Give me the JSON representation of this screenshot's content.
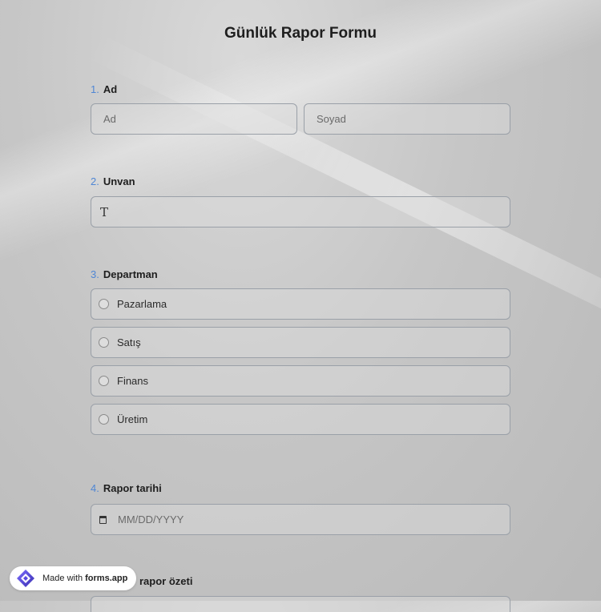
{
  "form": {
    "title": "Günlük Rapor Formu"
  },
  "q1": {
    "number": "1.",
    "label": "Ad",
    "first_placeholder": "Ad",
    "last_placeholder": "Soyad"
  },
  "q2": {
    "number": "2.",
    "label": "Unvan",
    "icon": "text-icon",
    "icon_glyph": "T"
  },
  "q3": {
    "number": "3.",
    "label": "Departman",
    "options": [
      "Pazarlama",
      "Satış",
      "Finans",
      "Üretim"
    ]
  },
  "q4": {
    "number": "4.",
    "label": "Rapor tarihi",
    "placeholder": "MM/DD/YYYY",
    "icon": "calendar-icon"
  },
  "q5": {
    "label_visible": "rapor özeti"
  },
  "badge": {
    "prefix": "Made with",
    "brand": "forms.app"
  },
  "colors": {
    "question_number": "#4f86d4",
    "field_border": "#9aa0a8",
    "badge_logo_start": "#6a5cff",
    "badge_logo_end": "#3a2fb0"
  }
}
